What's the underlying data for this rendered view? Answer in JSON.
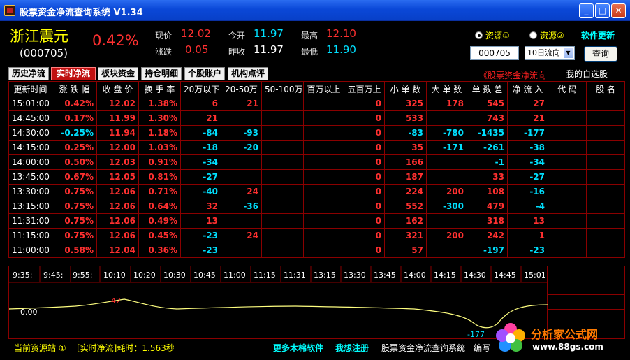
{
  "window": {
    "title": "股票资金净流查询系统  V1.34",
    "min": "_",
    "max": "□",
    "close": "✕"
  },
  "stock": {
    "name": "浙江震元",
    "code": "(000705)",
    "change_pct": "0.42%"
  },
  "quote": {
    "labels": {
      "price": "现价",
      "change": "涨跌",
      "open": "今开",
      "prev_close": "昨收",
      "high": "最高",
      "low": "最低"
    },
    "price": "12.02",
    "change": "0.05",
    "open": "11.97",
    "prev_close": "11.97",
    "high": "12.10",
    "low": "11.90"
  },
  "source": {
    "option1": "资源①",
    "option2": "资源②",
    "update": "软件更新"
  },
  "search": {
    "code_value": "000705",
    "mode_value": "10日流向",
    "query_label": "查询"
  },
  "tabs": [
    "历史净流",
    "实时净流",
    "板块资金",
    "持仓明细",
    "个股账户",
    "机构点评"
  ],
  "flow_direction": "《股票资金净流向",
  "watchlist": {
    "title": "我的自选股",
    "columns": [
      "代 码",
      "股 名"
    ]
  },
  "table": {
    "columns": [
      "更新时间",
      "涨 跌 幅",
      "收 盘 价",
      "换 手 率",
      "20万以下",
      "20-50万",
      "50-100万",
      "百万以上",
      "五百万上",
      "小 单 数",
      "大 单 数",
      "单 数 差",
      "净 流 入"
    ],
    "rows": [
      [
        "15:01:00",
        "0.42%",
        "12.02",
        "1.38%",
        "6",
        "21",
        "",
        "",
        "0",
        "325",
        "178",
        "545",
        "27"
      ],
      [
        "14:45:00",
        "0.17%",
        "11.99",
        "1.30%",
        "21",
        "",
        "",
        "",
        "0",
        "533",
        "",
        "743",
        "21"
      ],
      [
        "14:30:00",
        "-0.25%",
        "11.94",
        "1.18%",
        "-84",
        "-93",
        "",
        "",
        "0",
        "-83",
        "-780",
        "-1435",
        "-177"
      ],
      [
        "14:15:00",
        "0.25%",
        "12.00",
        "1.03%",
        "-18",
        "-20",
        "",
        "",
        "0",
        "35",
        "-171",
        "-261",
        "-38"
      ],
      [
        "14:00:00",
        "0.50%",
        "12.03",
        "0.91%",
        "-34",
        "",
        "",
        "",
        "0",
        "166",
        "",
        "-1",
        "-34"
      ],
      [
        "13:45:00",
        "0.67%",
        "12.05",
        "0.81%",
        "-27",
        "",
        "",
        "",
        "0",
        "187",
        "",
        "33",
        "-27"
      ],
      [
        "13:30:00",
        "0.75%",
        "12.06",
        "0.71%",
        "-40",
        "24",
        "",
        "",
        "0",
        "224",
        "200",
        "108",
        "-16"
      ],
      [
        "13:15:00",
        "0.75%",
        "12.06",
        "0.64%",
        "32",
        "-36",
        "",
        "",
        "0",
        "552",
        "-300",
        "479",
        "-4"
      ],
      [
        "11:31:00",
        "0.75%",
        "12.06",
        "0.49%",
        "13",
        "",
        "",
        "",
        "0",
        "162",
        "",
        "318",
        "13"
      ],
      [
        "11:15:00",
        "0.75%",
        "12.06",
        "0.45%",
        "-23",
        "24",
        "",
        "",
        "0",
        "321",
        "200",
        "242",
        "1"
      ],
      [
        "11:00:00",
        "0.58%",
        "12.04",
        "0.36%",
        "-23",
        "",
        "",
        "",
        "0",
        "57",
        "",
        "-197",
        "-23"
      ]
    ]
  },
  "chart": {
    "ticks": [
      "9:35:",
      "9:45:",
      "9:55:",
      "10:10",
      "10:20",
      "10:30",
      "10:45",
      "11:00",
      "11:15",
      "11:31",
      "13:15",
      "13:30",
      "13:45",
      "14:00",
      "14:15",
      "14:30",
      "14:45",
      "15:01"
    ],
    "zero_label": "0.00",
    "max_label": "42",
    "min_label": "-177",
    "line_color": "#ffff80"
  },
  "status": {
    "source": "当前资源站 ①",
    "timing": "[实时净流]耗时：1.563秒",
    "more_software": "更多木棉软件",
    "register": "我想注册",
    "app_name": "股票资金净流查询系统",
    "editor": "编写"
  },
  "watermark": {
    "text": "分析家公式网",
    "url": "www.88gs.com"
  },
  "colors": {
    "pos": "#ff3030",
    "neg": "#00e0ff",
    "grid": "#8a0000"
  }
}
